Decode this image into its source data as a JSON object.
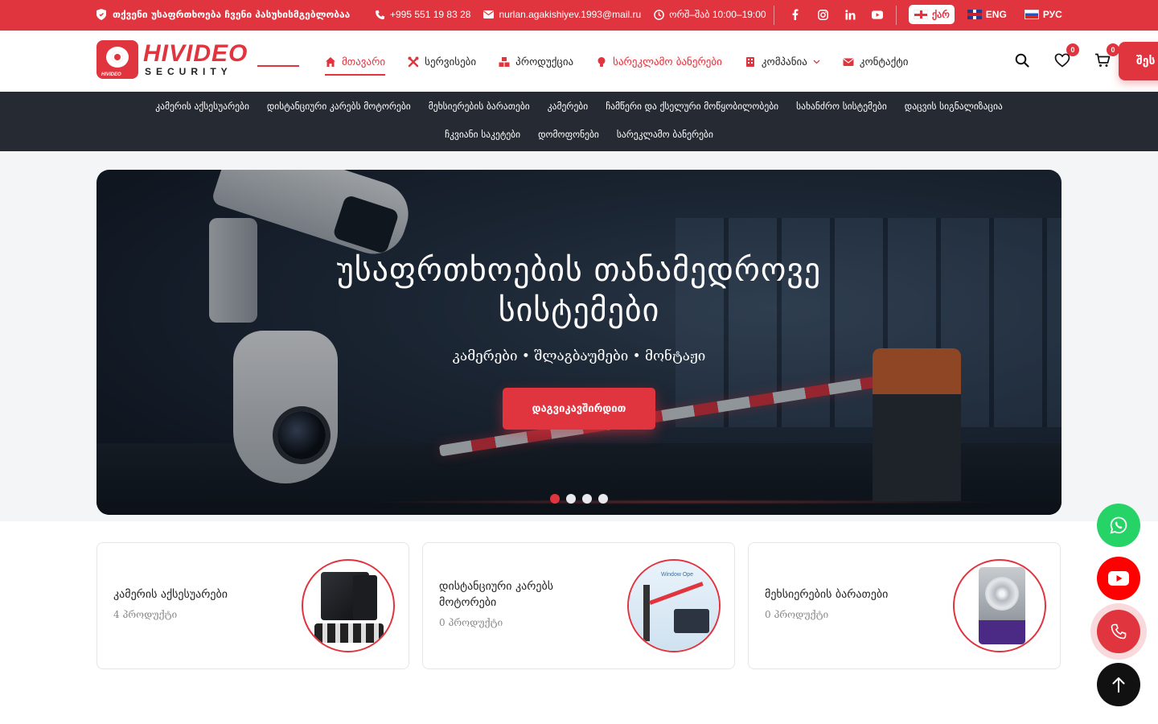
{
  "topbar": {
    "slogan": "თქვენი უსაფრთხოება ჩვენი პასუხისმგებლობაა",
    "phone": "+995 551 19 83 28",
    "email": "nurlan.agakishiyev.1993@mail.ru",
    "hours": "ორშ–შაბ 10:00–19:00",
    "socials": [
      "facebook-icon",
      "instagram-icon",
      "linkedin-icon",
      "youtube-icon"
    ],
    "languages": [
      {
        "label": "ქარ",
        "active": true
      },
      {
        "label": "ENG",
        "active": false
      },
      {
        "label": "РУС",
        "active": false
      }
    ]
  },
  "logo": {
    "name": "HIVIDEO",
    "tagline": "SECURITY",
    "badge_text": "HIVIDEO"
  },
  "nav": {
    "home": "მთავარი",
    "services": "სერვისები",
    "products": "პროდუქცია",
    "banners": "სარეკლამო ბანერები",
    "company": "კომპანია",
    "contact": "კონტაქტი"
  },
  "tools": {
    "wishlist_count": "0",
    "cart_count": "0",
    "login_label": "შეს"
  },
  "categories": {
    "row1": [
      "კამერის აქსესუარები",
      "დისტანციური კარებს მოტორები",
      "მეხსიერების ბარათები",
      "კამერები",
      "ჩამწერი და ქსელური მოწყობილობები",
      "სახანძრო სისტემები",
      "დაცვის სიგნალიზაცია"
    ],
    "row2": [
      "ჩკვიანი საკეტები",
      "დომოფონები",
      "სარეკლამო ბანერები"
    ]
  },
  "hero": {
    "title_line1": "უსაფრთხოების თანამედროვე",
    "title_line2": "სისტემები",
    "subtitle": "კამერები • შლაგბაუმები • მონტაჟი",
    "cta": "დაგვიკავშირდით",
    "slides": 4,
    "active_slide": 1
  },
  "cards": [
    {
      "title": "კამერის აქსესუარები",
      "count": "4 პროდუქტი"
    },
    {
      "title": "დისტანციური კარებს მოტორები",
      "count": "0 პროდუქტი"
    },
    {
      "title": "მეხსიერების ბარათები",
      "count": "0 პროდუქტი"
    }
  ],
  "card_images": {
    "gate_caption": "Window Ope"
  },
  "colors": {
    "accent": "#e0343f",
    "dark_bar": "#262b33",
    "whatsapp": "#25d366",
    "youtube": "#ff0000"
  }
}
